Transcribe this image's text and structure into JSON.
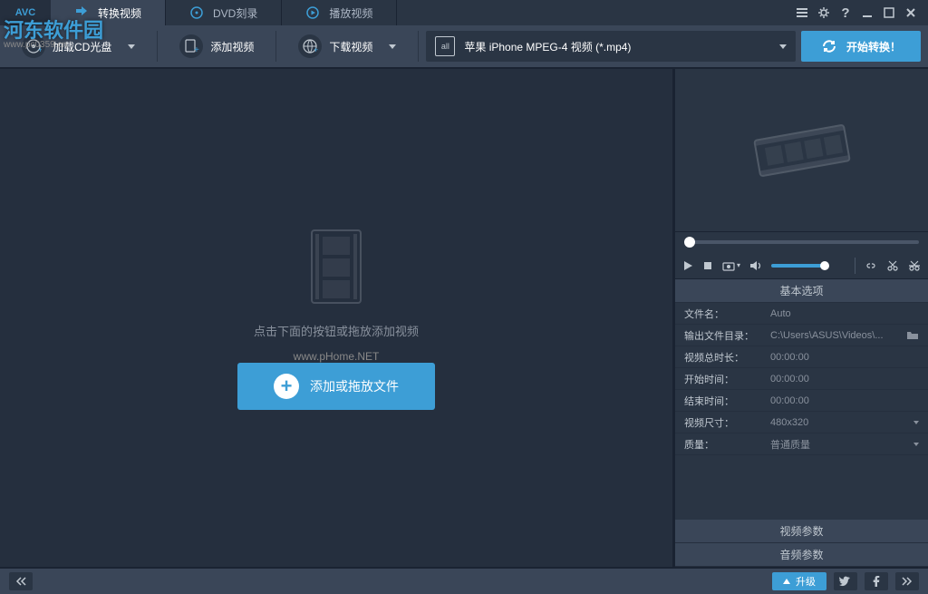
{
  "tabs": {
    "convert": "转换视频",
    "burn": "DVD刻录",
    "play": "播放视频"
  },
  "watermark": {
    "site": "河东软件园",
    "sub": "www.pc0359.cn",
    "url": "www.pHome.NET",
    "logo_small": "AVC"
  },
  "toolbar": {
    "load_cd": "加载CD光盘",
    "add_video": "添加视频",
    "download_video": "下载视频",
    "format_preset": "苹果 iPhone MPEG-4 视频 (*.mp4)",
    "format_all": "all",
    "start": "开始转换！"
  },
  "empty": {
    "hint": "点击下面的按钮或拖放添加视频",
    "button": "添加或拖放文件"
  },
  "panel_basic": "基本选项",
  "props": {
    "filename_label": "文件名：",
    "filename_value": "Auto",
    "outdir_label": "输出文件目录：",
    "outdir_value": "C:\\Users\\ASUS\\Videos\\...",
    "duration_label": "视频总时长：",
    "duration_value": "00:00:00",
    "start_label": "开始时间：",
    "start_value": "00:00:00",
    "end_label": "结束时间：",
    "end_value": "00:00:00",
    "size_label": "视频尺寸：",
    "size_value": "480x320",
    "quality_label": "质量：",
    "quality_value": "普通质量"
  },
  "panel_video_params": "视频参数",
  "panel_audio_params": "音频参数",
  "footer": {
    "upgrade": "升级"
  }
}
